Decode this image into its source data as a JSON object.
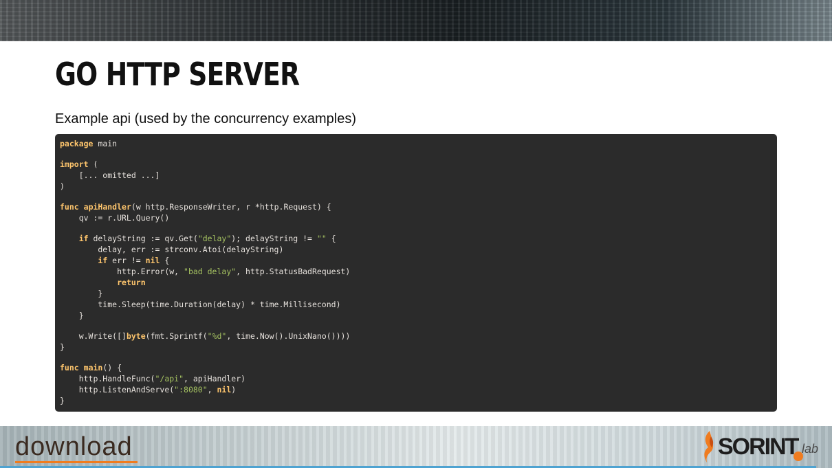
{
  "slide": {
    "title": "Go HTTP Server",
    "subtitle": "Example api (used by the concurrency examples)"
  },
  "code": {
    "language": "go",
    "lines": [
      [
        {
          "t": "package",
          "c": "kw"
        },
        {
          "t": " main"
        }
      ],
      [],
      [
        {
          "t": "import",
          "c": "kw"
        },
        {
          "t": " ("
        }
      ],
      [
        {
          "t": "    [... omitted ...]"
        }
      ],
      [
        {
          "t": ")"
        }
      ],
      [],
      [
        {
          "t": "func",
          "c": "kw"
        },
        {
          "t": " "
        },
        {
          "t": "apiHandler",
          "c": "fn"
        },
        {
          "t": "(w http.ResponseWriter, r *http.Request) {"
        }
      ],
      [
        {
          "t": "    qv := r.URL.Query()"
        }
      ],
      [],
      [
        {
          "t": "    "
        },
        {
          "t": "if",
          "c": "kw"
        },
        {
          "t": " delayString := qv.Get("
        },
        {
          "t": "\"delay\"",
          "c": "str"
        },
        {
          "t": "); delayString != "
        },
        {
          "t": "\"\"",
          "c": "str"
        },
        {
          "t": " {"
        }
      ],
      [
        {
          "t": "        delay, err := strconv.Atoi(delayString)"
        }
      ],
      [
        {
          "t": "        "
        },
        {
          "t": "if",
          "c": "kw"
        },
        {
          "t": " err != "
        },
        {
          "t": "nil",
          "c": "kw"
        },
        {
          "t": " {"
        }
      ],
      [
        {
          "t": "            http.Error(w, "
        },
        {
          "t": "\"bad delay\"",
          "c": "str"
        },
        {
          "t": ", http.StatusBadRequest)"
        }
      ],
      [
        {
          "t": "            "
        },
        {
          "t": "return",
          "c": "kw"
        }
      ],
      [
        {
          "t": "        }"
        }
      ],
      [
        {
          "t": "        time.Sleep(time.Duration(delay) * time.Millisecond)"
        }
      ],
      [
        {
          "t": "    }"
        }
      ],
      [],
      [
        {
          "t": "    w.Write([]"
        },
        {
          "t": "byte",
          "c": "kw"
        },
        {
          "t": "(fmt.Sprintf("
        },
        {
          "t": "\"%d\"",
          "c": "str"
        },
        {
          "t": ", time.Now().UnixNano())))"
        }
      ],
      [
        {
          "t": "}"
        }
      ],
      [],
      [
        {
          "t": "func",
          "c": "kw"
        },
        {
          "t": " "
        },
        {
          "t": "main",
          "c": "fn"
        },
        {
          "t": "() {"
        }
      ],
      [
        {
          "t": "    http.HandleFunc("
        },
        {
          "t": "\"/api\"",
          "c": "str"
        },
        {
          "t": ", apiHandler)"
        }
      ],
      [
        {
          "t": "    http.ListenAndServe("
        },
        {
          "t": "\":8080\"",
          "c": "str"
        },
        {
          "t": ", "
        },
        {
          "t": "nil",
          "c": "kw"
        },
        {
          "t": ")"
        }
      ],
      [
        {
          "t": "}"
        }
      ]
    ]
  },
  "footer": {
    "left_logo": "download",
    "right_logo": {
      "brand": "SORINT",
      "suffix": "lab"
    },
    "colors": {
      "accent_orange": "#f07c1f",
      "strip_blue": "#4fa3d1",
      "code_bg": "#2b2b2b",
      "keyword": "#ffc66d",
      "string": "#a5c261"
    }
  }
}
